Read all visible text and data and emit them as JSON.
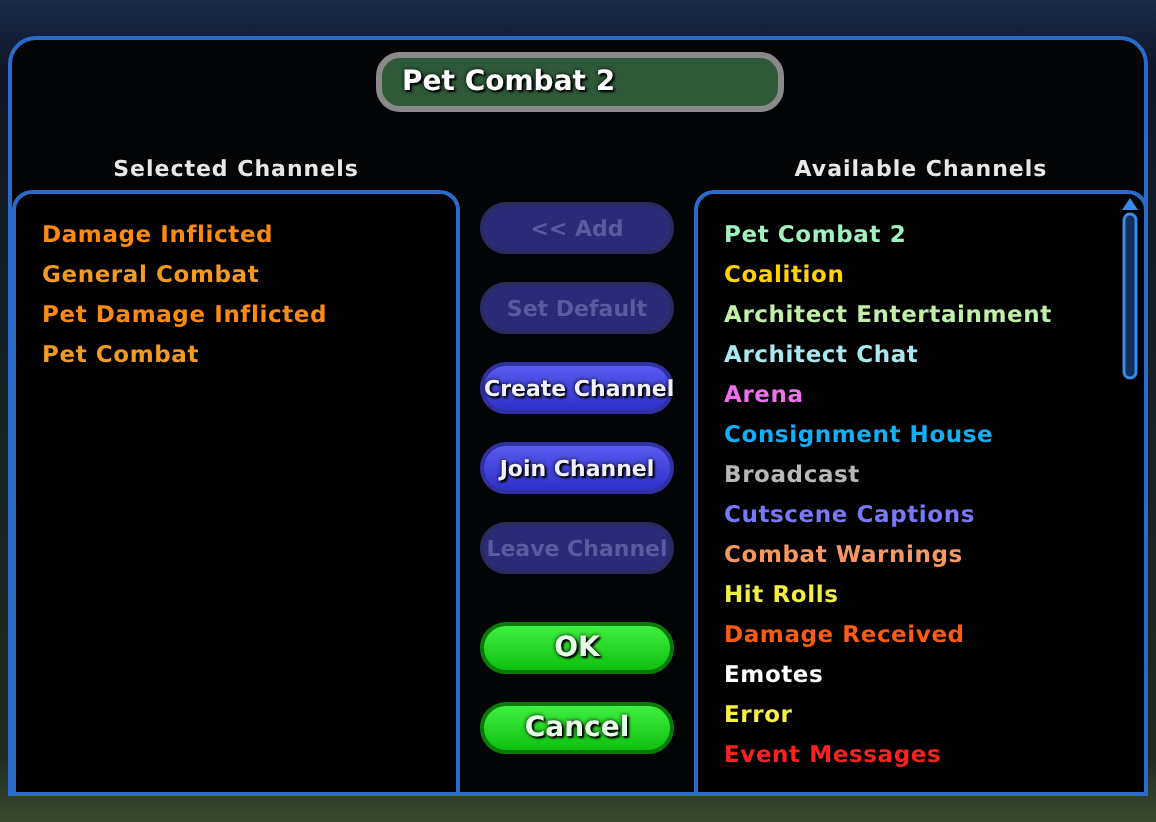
{
  "title_field": {
    "value": "Pet Combat 2"
  },
  "selected_channels": {
    "heading": "Selected Channels",
    "items": [
      {
        "label": "Damage Inflicted",
        "color": "#ff8a10"
      },
      {
        "label": "General Combat",
        "color": "#f59a20"
      },
      {
        "label": "Pet Damage Inflicted",
        "color": "#ff8a10"
      },
      {
        "label": "Pet Combat",
        "color": "#f59a20"
      }
    ]
  },
  "buttons": [
    {
      "label": "<< Add",
      "kind": "blue",
      "disabled": true
    },
    {
      "label": "Set Default",
      "kind": "blue",
      "disabled": true
    },
    {
      "label": "Create Channel",
      "kind": "blue",
      "disabled": false
    },
    {
      "label": "Join Channel",
      "kind": "blue",
      "disabled": false
    },
    {
      "label": "Leave Channel",
      "kind": "blue",
      "disabled": true
    },
    {
      "label": "OK",
      "kind": "green",
      "disabled": false
    },
    {
      "label": "Cancel",
      "kind": "green",
      "disabled": false
    }
  ],
  "available_channels": {
    "heading": "Available Channels",
    "items": [
      {
        "label": "Pet Combat 2",
        "color": "#a0f0c0"
      },
      {
        "label": "Coalition",
        "color": "#ffd200"
      },
      {
        "label": "Architect Entertainment",
        "color": "#c0f0a8"
      },
      {
        "label": "Architect Chat",
        "color": "#a8e8f0"
      },
      {
        "label": "Arena",
        "color": "#f070f0"
      },
      {
        "label": "Consignment House",
        "color": "#10b0f8"
      },
      {
        "label": "Broadcast",
        "color": "#b8b8b8"
      },
      {
        "label": "Cutscene Captions",
        "color": "#7878ff"
      },
      {
        "label": "Combat Warnings",
        "color": "#f89860"
      },
      {
        "label": "Hit Rolls",
        "color": "#f0f040"
      },
      {
        "label": "Damage Received",
        "color": "#ff5a10"
      },
      {
        "label": "Emotes",
        "color": "#ffffff"
      },
      {
        "label": "Error",
        "color": "#f8f040"
      },
      {
        "label": "Event Messages",
        "color": "#ff2020"
      }
    ]
  }
}
